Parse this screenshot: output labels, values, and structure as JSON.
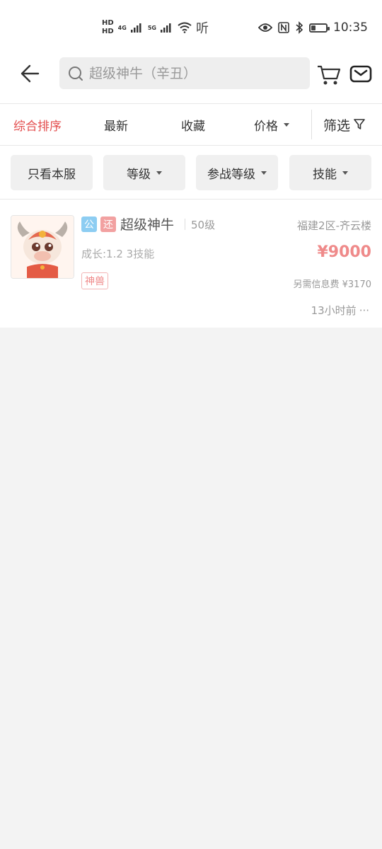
{
  "status_bar": {
    "hd_top": "HD",
    "hd_bottom": "HD",
    "net1": "4G",
    "net2": "5G",
    "listen_icon_text": "听",
    "time": "10:35",
    "battery_level": 0.3
  },
  "header": {
    "search_placeholder": "超级神牛（辛丑）"
  },
  "sort_bar": {
    "items": [
      "综合排序",
      "最新",
      "收藏",
      "价格"
    ],
    "filter_label": "筛选"
  },
  "filter_chips": [
    "只看本服",
    "等级",
    "参战等级",
    "技能"
  ],
  "listing": {
    "badge_public": "公",
    "badge_return": "还",
    "name": "超级神牛",
    "level": "50级",
    "server": "福建2区-齐云楼",
    "growth_skills": "成长:1.2 3技能",
    "price": "¥9000",
    "tag": "神兽",
    "fee": "另需信息费 ¥3170",
    "time": "13小时前",
    "more": "···"
  }
}
